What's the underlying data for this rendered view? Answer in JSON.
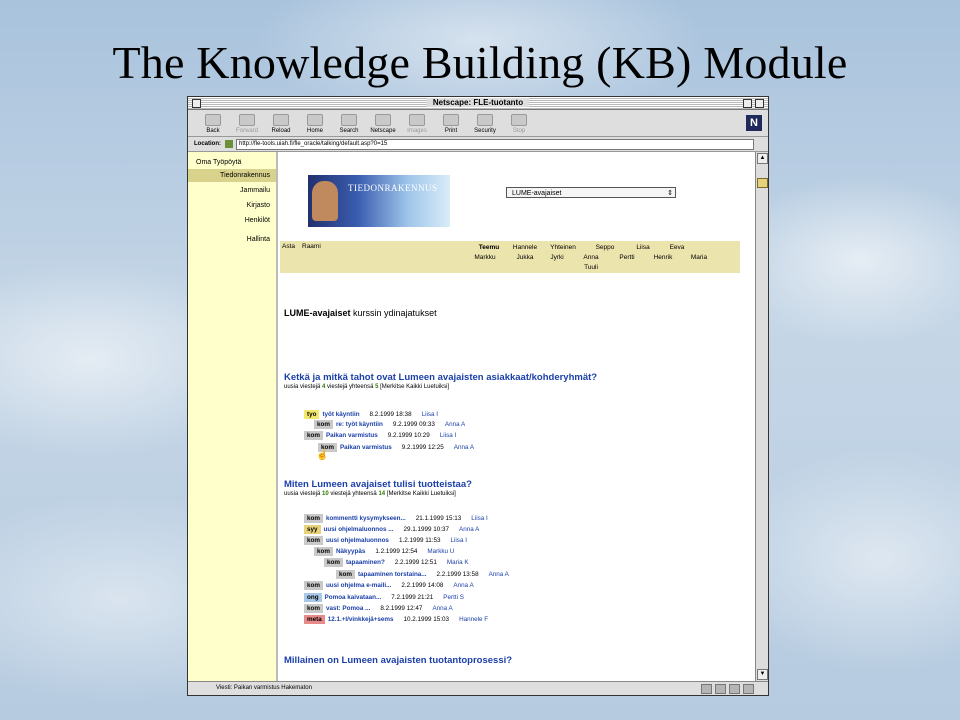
{
  "slide": {
    "title": "The Knowledge Building (KB) Module"
  },
  "window": {
    "title": "Netscape: FLE-tuotanto"
  },
  "toolbar": {
    "buttons": [
      "Back",
      "Forward",
      "Reload",
      "Home",
      "Search",
      "Netscape",
      "Images",
      "Print",
      "Security",
      "Stop"
    ],
    "logo": "N"
  },
  "location": {
    "label": "Location:",
    "url": "http://fle-tools.uiah.fi/fle_oracle/talking/default.asp?0=15"
  },
  "sidebar": {
    "items": [
      "Oma Työpöytä",
      "Tiedonrakennus",
      "Jammailu",
      "Kirjasto",
      "Henkilöt",
      "Hallinta"
    ]
  },
  "banner": {
    "text": "TIEDONRAKENNUS"
  },
  "course_select": {
    "value": "LUME-avajaiset",
    "arrow": "⇕"
  },
  "people": {
    "labels": [
      "Asta",
      "Raami"
    ],
    "row1": [
      "Teemu",
      "Hannele",
      "Yhteinen",
      "Seppo",
      "Liisa",
      "Eeva"
    ],
    "row2": [
      "Markku",
      "Jukka",
      "Jyrki",
      "Anna",
      "Pertti",
      "Henrik",
      "Maria"
    ],
    "row3": [
      "Tuuli"
    ]
  },
  "course": {
    "name": "LUME-avajaiset",
    "suffix": " kurssin ydinajatukset"
  },
  "topics": [
    {
      "title": "Ketkä ja mitkä tahot ovat Lumeen avajaisten asiakkaat/kohderyhmät?",
      "sub_prefix": "uusia viestejä",
      "new_count": "4",
      "sub_mid": "viestejä yhteensä",
      "total": "5",
      "mark_all": "[Merkitse Kaikki Luetuiksi]",
      "messages": [
        {
          "tag": "tyo",
          "subject": "työt käyntiin",
          "date": "8.2.1999 18:38",
          "author": "Liisa I"
        },
        {
          "tag": "kom",
          "subject": "re: työt käyntiin",
          "date": "9.2.1999 09:33",
          "author": "Anna A"
        },
        {
          "tag": "kom",
          "subject": "Paikan varmistus",
          "date": "9.2.1999 10:29",
          "author": "Liisa I"
        },
        {
          "tag": "kom",
          "subject": "Paikan varmistus",
          "date": "9.2.1999 12:25",
          "author": "Anna A"
        }
      ]
    },
    {
      "title": "Miten Lumeen avajaiset tulisi tuotteistaa?",
      "sub_prefix": "uusia viestejä",
      "new_count": "10",
      "sub_mid": "viestejä yhteensä",
      "total": "14",
      "mark_all": "[Merkitse Kaikki Luetuiksi]",
      "messages": [
        {
          "tag": "kom",
          "subject": "kommentti kysymykseen...",
          "date": "21.1.1999 15:13",
          "author": "Liisa I"
        },
        {
          "tag": "syy",
          "subject": "uusi ohjelmaluonnos ...",
          "date": "29.1.1999 10:37",
          "author": "Anna A"
        },
        {
          "tag": "kom",
          "subject": "uusi ohjelmaluonnos",
          "date": "1.2.1999 11:53",
          "author": "Liisa I"
        },
        {
          "tag": "kom",
          "subject": "Näkyypäs",
          "date": "1.2.1999 12:54",
          "author": "Markku U"
        },
        {
          "tag": "kom",
          "subject": "tapaaminen?",
          "date": "2.2.1999 12:51",
          "author": "Maria K"
        },
        {
          "tag": "kom",
          "subject": "tapaaminen torstaina...",
          "date": "2.2.1999 13:58",
          "author": "Anna A"
        },
        {
          "tag": "kom",
          "subject": "uusi ohjelma e-maili...",
          "date": "2.2.1999 14:08",
          "author": "Anna A"
        },
        {
          "tag": "ong",
          "subject": "Pomoa kaivataan...",
          "date": "7.2.1999 21:21",
          "author": "Pertti S"
        },
        {
          "tag": "kom",
          "subject": "vast: Pomoa ...",
          "date": "8.2.1999 12:47",
          "author": "Anna A"
        },
        {
          "tag": "meta",
          "subject": "12.1.+l/vinkkejä+sems",
          "date": "10.2.1999 15:03",
          "author": "Hannele F"
        }
      ]
    },
    {
      "title": "Millainen on Lumeen avajaisten tuotantoprosessi?"
    }
  ],
  "status": {
    "text": "Viesti: Paikan varmistus Hakematon"
  },
  "colors": {
    "tyo": "#f2e86a",
    "kom": "#c9c9c9",
    "syy": "#e8d27a",
    "ong": "#a8c8e8",
    "meta": "#e88a8a"
  }
}
